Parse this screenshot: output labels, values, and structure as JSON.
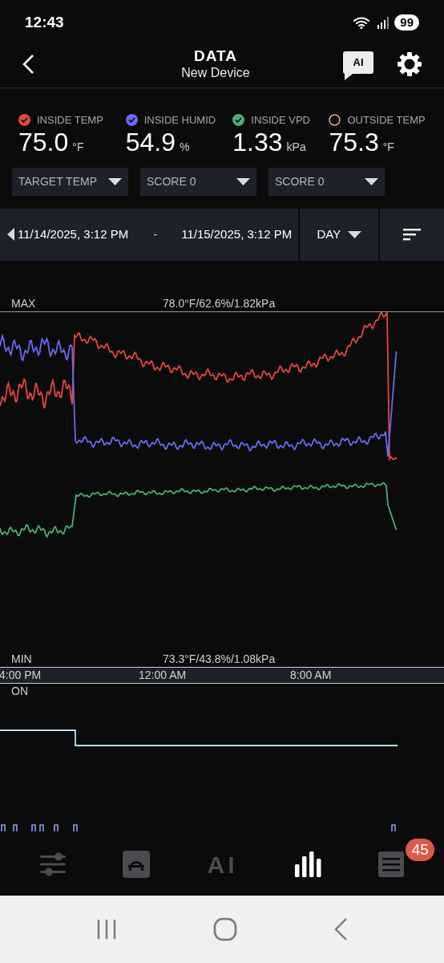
{
  "status_bar": {
    "time": "12:43",
    "battery": "99"
  },
  "header": {
    "title": "DATA",
    "subtitle": "New Device",
    "ai_button": "AI"
  },
  "legend": [
    {
      "label": "INSIDE TEMP",
      "value": "75.0",
      "unit": "°F",
      "checked": true,
      "color": "#e5473f"
    },
    {
      "label": "INSIDE HUMID",
      "value": "54.9",
      "unit": "%",
      "checked": true,
      "color": "#6a6af0"
    },
    {
      "label": "INSIDE VPD",
      "value": "1.33",
      "unit": "kPa",
      "checked": true,
      "color": "#4caf72"
    },
    {
      "label": "OUTSIDE TEMP",
      "value": "75.3",
      "unit": "°F",
      "checked": false,
      "color": "#e8a090"
    }
  ],
  "dropdowns": [
    "TARGET TEMP",
    "SCORE 0",
    "SCORE 0"
  ],
  "date_range": {
    "start": "11/14/2025, 3:12 PM",
    "separator": "-",
    "end": "11/15/2025, 3:12 PM",
    "period": "DAY"
  },
  "chart": {
    "max_label": "MAX",
    "max_value": "78.0°F/62.6%/1.82kPa",
    "min_label": "MIN",
    "min_value": "73.3°F/43.8%/1.08kPa",
    "time_labels": [
      "4:00 PM",
      "12:00 AM",
      "8:00 AM"
    ],
    "on_label": "ON"
  },
  "nav": [
    {
      "kind": "sliders",
      "selected": false
    },
    {
      "kind": "helmet",
      "selected": false
    },
    {
      "kind": "ai",
      "label": "AI",
      "selected": false
    },
    {
      "kind": "bars",
      "selected": true
    },
    {
      "kind": "list",
      "selected": false,
      "badge": "45"
    }
  ]
}
